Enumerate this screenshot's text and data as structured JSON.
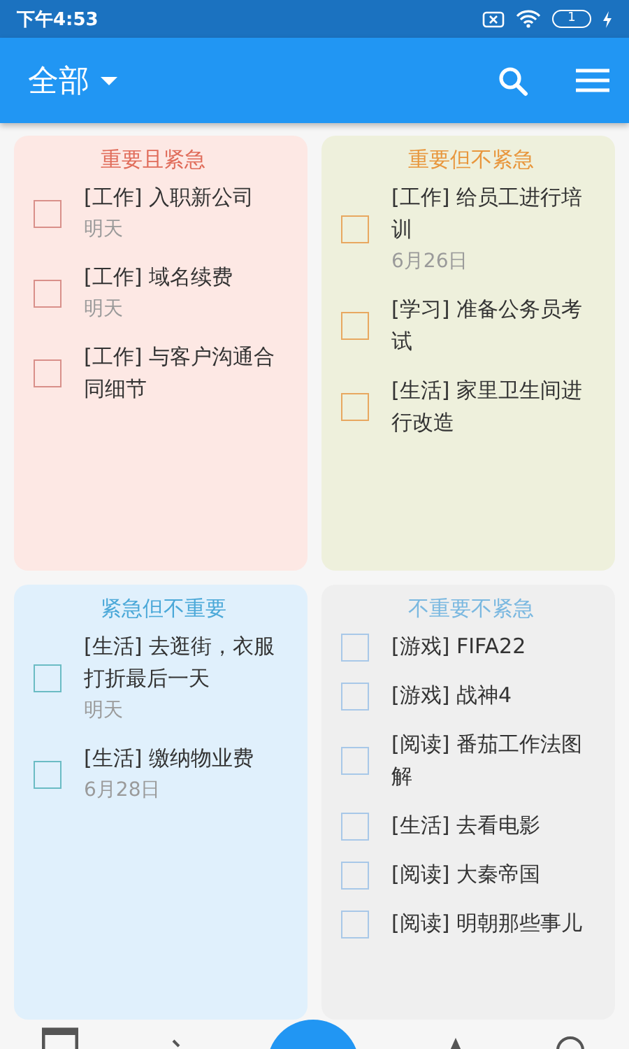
{
  "status_bar": {
    "time": "下午4:53",
    "battery": "1"
  },
  "app_bar": {
    "title": "全部"
  },
  "quadrants": [
    {
      "title": "重要且紧急",
      "color": "#e06c5a",
      "items": [
        {
          "title": "[工作] 入职新公司",
          "due": "明天",
          "checked": false
        },
        {
          "title": "[工作] 域名续费",
          "due": "明天",
          "checked": false
        },
        {
          "title": "[工作] 与客户沟通合同细节",
          "checked": false
        }
      ]
    },
    {
      "title": "重要但不紧急",
      "color": "#e8963c",
      "items": [
        {
          "title": "[工作] 给员工进行培训",
          "due": "6月26日",
          "checked": false
        },
        {
          "title": "[学习] 准备公务员考试",
          "checked": false
        },
        {
          "title": "[生活] 家里卫生间进行改造",
          "checked": false
        }
      ]
    },
    {
      "title": "紧急但不重要",
      "color": "#4aa8d8",
      "items": [
        {
          "title": "[生活] 去逛街，衣服打折最后一天",
          "due": "明天",
          "checked": false
        },
        {
          "title": "[生活] 缴纳物业费",
          "due": "6月28日",
          "checked": false
        }
      ]
    },
    {
      "title": "不重要不紧急",
      "color": "#7ab8e0",
      "items": [
        {
          "title": "[游戏] FIFA22",
          "checked": false
        },
        {
          "title": "[游戏] 战神4",
          "checked": false
        },
        {
          "title": "[阅读] 番茄工作法图解",
          "checked": false
        },
        {
          "title": "[生活] 去看电影",
          "checked": false
        },
        {
          "title": "[阅读] 大秦帝国",
          "checked": false
        },
        {
          "title": "[阅读] 明朝那些事儿",
          "checked": false
        }
      ]
    }
  ]
}
